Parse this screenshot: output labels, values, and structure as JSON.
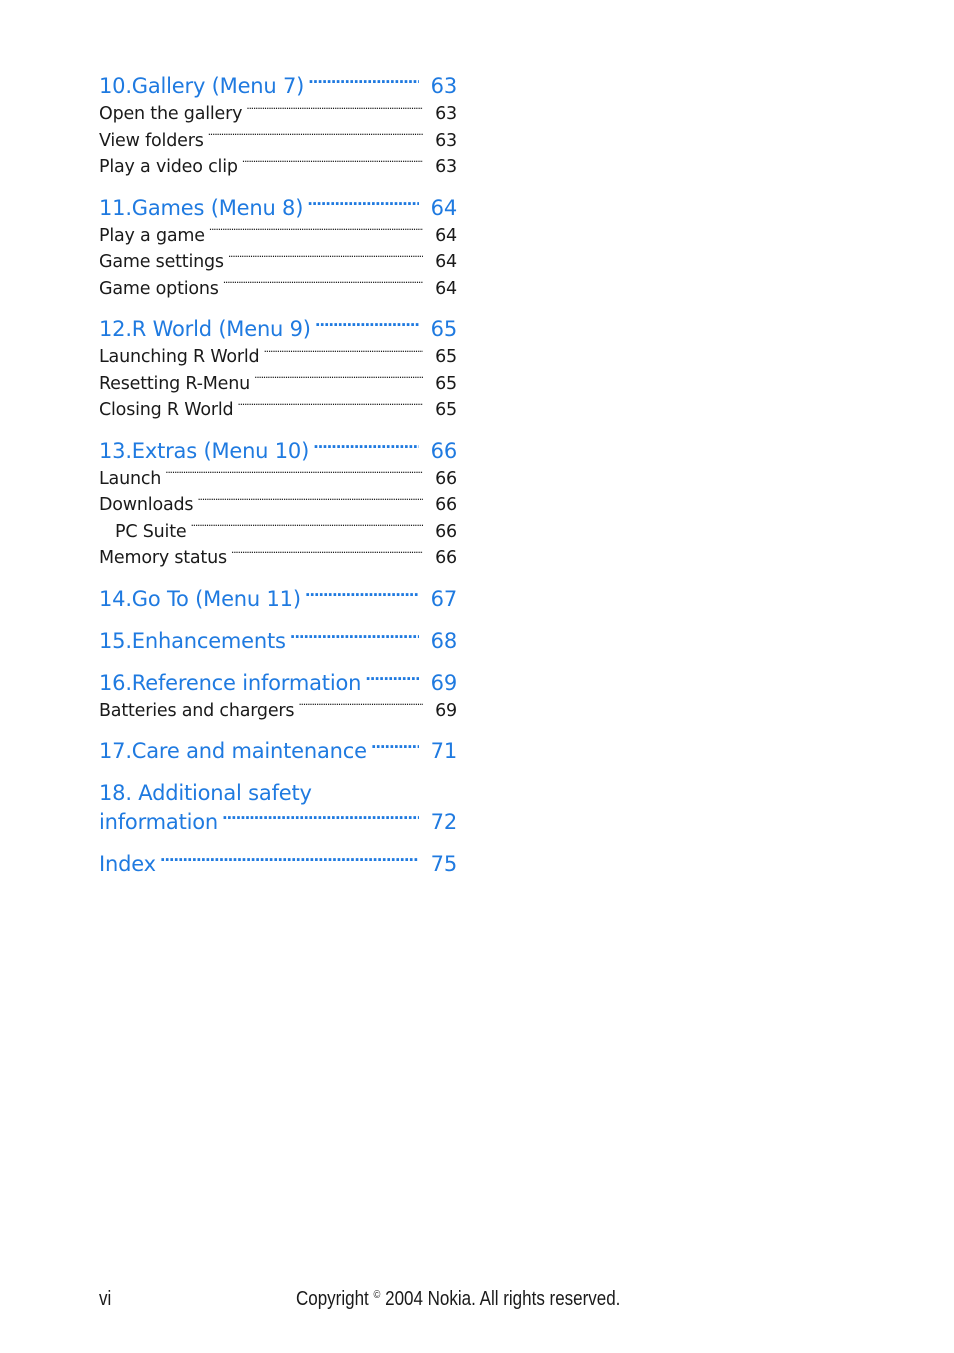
{
  "toc": [
    {
      "title": "10.Gallery (Menu 7)",
      "page": "63",
      "items": [
        {
          "title": "Open the gallery",
          "page": "63"
        },
        {
          "title": "View folders",
          "page": "63"
        },
        {
          "title": "Play a video clip",
          "page": "63"
        }
      ]
    },
    {
      "title": "11.Games (Menu 8)",
      "page": "64",
      "items": [
        {
          "title": "Play a game",
          "page": "64"
        },
        {
          "title": "Game settings",
          "page": "64"
        },
        {
          "title": "Game options",
          "page": "64"
        }
      ]
    },
    {
      "title": "12.R World (Menu 9)",
      "page": "65",
      "items": [
        {
          "title": "Launching R World",
          "page": "65"
        },
        {
          "title": "Resetting R-Menu",
          "page": "65"
        },
        {
          "title": "Closing R World",
          "page": "65"
        }
      ]
    },
    {
      "title": "13.Extras (Menu 10)",
      "page": "66",
      "items": [
        {
          "title": "Launch",
          "page": "66"
        },
        {
          "title": "Downloads",
          "page": "66"
        },
        {
          "title": "PC Suite",
          "page": "66",
          "indent": true
        },
        {
          "title": "Memory status",
          "page": "66"
        }
      ]
    },
    {
      "title": "14.Go To (Menu 11)",
      "page": "67",
      "items": []
    },
    {
      "title": "15.Enhancements",
      "page": "68",
      "items": []
    },
    {
      "title": "16.Reference information",
      "page": "69",
      "items": [
        {
          "title": "Batteries and chargers",
          "page": "69"
        }
      ]
    },
    {
      "title": "17.Care and maintenance",
      "page": "71",
      "items": []
    },
    {
      "title_line1": "18. Additional safety",
      "title": "information",
      "page": "72",
      "items": []
    },
    {
      "title": "Index",
      "page": "75",
      "items": []
    }
  ],
  "footer": {
    "page_number": "vi",
    "copyright_prefix": "Copyright",
    "copyright_symbol": "©",
    "copyright_text": "2004 Nokia. All rights reserved."
  },
  "colors": {
    "heading": "#1f7ae0",
    "text": "#1a1a1a"
  }
}
